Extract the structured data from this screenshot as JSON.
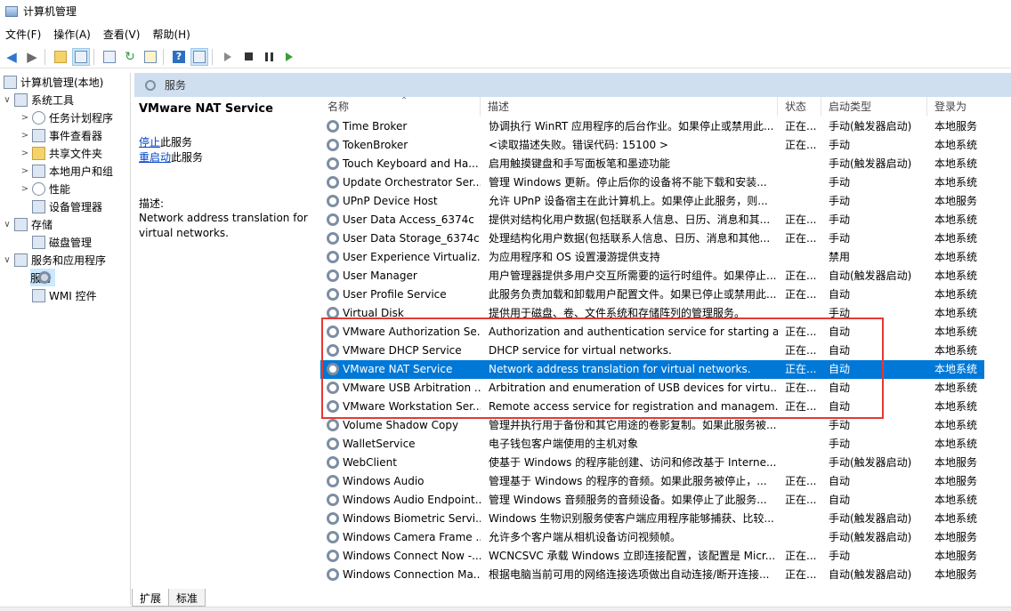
{
  "window": {
    "title": "计算机管理"
  },
  "menu": [
    "文件(F)",
    "操作(A)",
    "查看(V)",
    "帮助(H)"
  ],
  "tree": {
    "root": "计算机管理(本地)",
    "system_tools": "系统工具",
    "task_scheduler": "任务计划程序",
    "event_viewer": "事件查看器",
    "shared_folders": "共享文件夹",
    "local_users": "本地用户和组",
    "performance": "性能",
    "device_manager": "设备管理器",
    "storage": "存储",
    "disk_management": "磁盘管理",
    "services_apps": "服务和应用程序",
    "services": "服务",
    "wmi": "WMI 控件"
  },
  "header": {
    "title": "服务"
  },
  "detail": {
    "service_name": "VMware NAT Service",
    "stop_link": "停止",
    "stop_suffix": "此服务",
    "restart_link": "重启动",
    "restart_suffix": "此服务",
    "desc_label": "描述:",
    "desc_text": "Network address translation for virtual networks."
  },
  "table": {
    "columns": [
      "名称",
      "描述",
      "状态",
      "启动类型",
      "登录为"
    ],
    "rows": [
      [
        "Time Broker",
        "协调执行 WinRT 应用程序的后台作业。如果停止或禁用此...",
        "正在...",
        "手动(触发器启动)",
        "本地服务"
      ],
      [
        "TokenBroker",
        "<读取描述失败。错误代码: 15100 >",
        "正在...",
        "手动",
        "本地系统"
      ],
      [
        "Touch Keyboard and Ha...",
        "启用触摸键盘和手写面板笔和墨迹功能",
        "",
        "手动(触发器启动)",
        "本地系统"
      ],
      [
        "Update Orchestrator Ser...",
        "管理 Windows 更新。停止后你的设备将不能下载和安装...",
        "",
        "手动",
        "本地系统"
      ],
      [
        "UPnP Device Host",
        "允许 UPnP 设备宿主在此计算机上。如果停止此服务，则...",
        "",
        "手动",
        "本地服务"
      ],
      [
        "User Data Access_6374c",
        "提供对结构化用户数据(包括联系人信息、日历、消息和其...",
        "正在...",
        "手动",
        "本地系统"
      ],
      [
        "User Data Storage_6374c",
        "处理结构化用户数据(包括联系人信息、日历、消息和其他...",
        "正在...",
        "手动",
        "本地系统"
      ],
      [
        "User Experience Virtualiz...",
        "为应用程序和 OS 设置漫游提供支持",
        "",
        "禁用",
        "本地系统"
      ],
      [
        "User Manager",
        "用户管理器提供多用户交互所需要的运行时组件。如果停止...",
        "正在...",
        "自动(触发器启动)",
        "本地系统"
      ],
      [
        "User Profile Service",
        "此服务负责加载和卸载用户配置文件。如果已停止或禁用此...",
        "正在...",
        "自动",
        "本地系统"
      ],
      [
        "Virtual Disk",
        "提供用于磁盘、卷、文件系统和存储阵列的管理服务。",
        "",
        "手动",
        "本地系统"
      ],
      [
        "VMware Authorization Se...",
        "Authorization and authentication service for starting a...",
        "正在...",
        "自动",
        "本地系统"
      ],
      [
        "VMware DHCP Service",
        "DHCP service for virtual networks.",
        "正在...",
        "自动",
        "本地系统"
      ],
      [
        "VMware NAT Service",
        "Network address translation for virtual networks.",
        "正在...",
        "自动",
        "本地系统"
      ],
      [
        "VMware USB Arbitration ...",
        "Arbitration and enumeration of USB devices for virtu...",
        "正在...",
        "自动",
        "本地系统"
      ],
      [
        "VMware Workstation Ser...",
        "Remote access service for registration and managem...",
        "正在...",
        "自动",
        "本地系统"
      ],
      [
        "Volume Shadow Copy",
        "管理并执行用于备份和其它用途的卷影复制。如果此服务被...",
        "",
        "手动",
        "本地系统"
      ],
      [
        "WalletService",
        "电子钱包客户端使用的主机对象",
        "",
        "手动",
        "本地系统"
      ],
      [
        "WebClient",
        "使基于 Windows 的程序能创建、访问和修改基于 Interne...",
        "",
        "手动(触发器启动)",
        "本地服务"
      ],
      [
        "Windows Audio",
        "管理基于 Windows 的程序的音频。如果此服务被停止，...",
        "正在...",
        "自动",
        "本地服务"
      ],
      [
        "Windows Audio Endpoint...",
        "管理 Windows 音频服务的音频设备。如果停止了此服务...",
        "正在...",
        "自动",
        "本地系统"
      ],
      [
        "Windows Biometric Servi...",
        "Windows 生物识别服务使客户端应用程序能够捕获、比较...",
        "",
        "手动(触发器启动)",
        "本地系统"
      ],
      [
        "Windows Camera Frame ...",
        "允许多个客户端从相机设备访问视频帧。",
        "",
        "手动(触发器启动)",
        "本地服务"
      ],
      [
        "Windows Connect Now -...",
        "WCNCSVC 承载 Windows 立即连接配置，该配置是 Micr...",
        "正在...",
        "手动",
        "本地服务"
      ],
      [
        "Windows Connection Ma...",
        "根据电脑当前可用的网络连接选项做出自动连接/断开连接...",
        "正在...",
        "自动(触发器启动)",
        "本地服务"
      ]
    ],
    "selected_row": 13
  },
  "tabs": [
    "扩展",
    "标准"
  ]
}
